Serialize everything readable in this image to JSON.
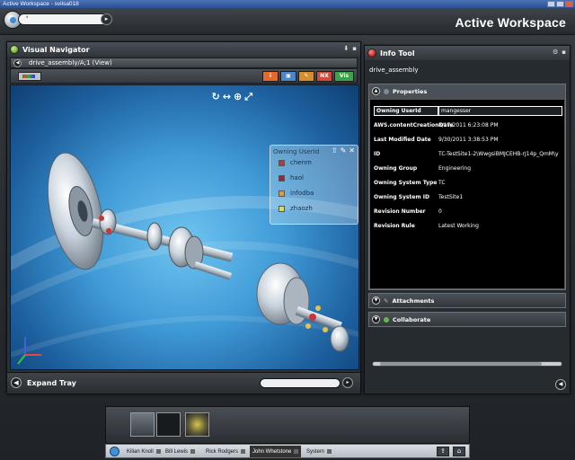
{
  "window": {
    "title": "Active Workspace - svilsa018"
  },
  "header": {
    "app_title": "Active Workspace",
    "search_value": "*"
  },
  "visual_navigator": {
    "title": "Visual Navigator",
    "breadcrumb": "drive_assembly/A;1 (View)",
    "toolbar_buttons": [
      {
        "label": "i",
        "color": "#e26a2c"
      },
      {
        "label": "▣",
        "color": "#4a86c8"
      },
      {
        "label": "✎",
        "color": "#d88d2b"
      },
      {
        "label": "NX",
        "color": "#d24a3a"
      },
      {
        "label": "Vis",
        "color": "#3fa24a"
      }
    ],
    "owning": {
      "header": "Owning UserId",
      "users": [
        {
          "name": "chenm",
          "color": "#b23a48"
        },
        {
          "name": "haol",
          "color": "#8a2b3a"
        },
        {
          "name": "infodba",
          "color": "#e69a2e"
        },
        {
          "name": "zhaozh",
          "color": "#d6dd59"
        }
      ]
    },
    "expand_tray": "Expand Tray"
  },
  "info_tool": {
    "title": "Info Tool",
    "object_name": "drive_assembly",
    "sections": {
      "properties": "Properties",
      "attachments": "Attachments",
      "collaborate": "Collaborate"
    },
    "properties": [
      {
        "key": "Owning UserId",
        "value": "mangesser",
        "selected": true
      },
      {
        "key": "AWS.contentCreationDate",
        "value": "8/17/2011 6:23:08 PM"
      },
      {
        "key": "Last Modified Date",
        "value": "9/30/2011 3:38:53 PM"
      },
      {
        "key": "ID",
        "value": "TC-TestSite1-2\\WwgsiBMJCEHB-rJ14p_QmM\\y"
      },
      {
        "key": "Owning Group",
        "value": "Engineering"
      },
      {
        "key": "Owning System Type",
        "value": "TC"
      },
      {
        "key": "Owning System ID",
        "value": "TestSite1"
      },
      {
        "key": "Revision Number",
        "value": "0"
      },
      {
        "key": "Revision Rule",
        "value": "Latest Working"
      }
    ]
  },
  "taskbar": {
    "users": [
      "Kilian Knoll",
      "Bill Lewis",
      "Rick Rodgers",
      "John Whetstone",
      "System"
    ],
    "active_index": 3
  }
}
